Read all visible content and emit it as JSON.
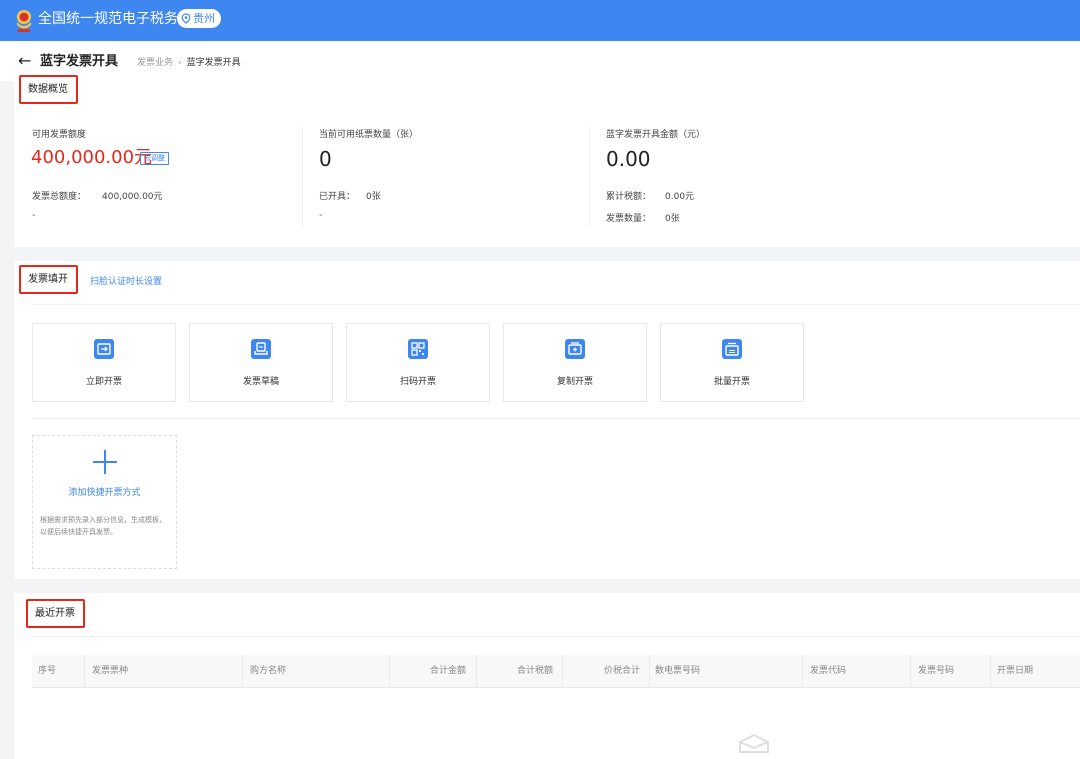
{
  "topbar": {
    "title": "全国统一规范电子税务局",
    "region": "贵州"
  },
  "header": {
    "title": "蓝字发票开具",
    "breadcrumb": [
      "发票业务",
      "蓝字发票开具"
    ]
  },
  "overview": {
    "section_label": "数据概览",
    "col1": {
      "label": "可用发票额度",
      "value": "400,000.00元",
      "button": "去调整",
      "total_label": "发票总额度：",
      "total_value": "400,000.00元",
      "dash": "-"
    },
    "col2": {
      "label": "当前可用纸票数量（张）",
      "value": "0",
      "issued_label": "已开具：",
      "issued_value": "0张",
      "dash": "-"
    },
    "col3": {
      "label": "蓝字发票开具金额（元）",
      "value": "0.00",
      "tax_label": "累计税额：",
      "tax_value": "0.00元",
      "count_label": "发票数量：",
      "count_value": "0张"
    }
  },
  "fill": {
    "section_label": "发票填开",
    "setting_link": "扫脸认证时长设置",
    "tiles": [
      {
        "label": "立即开票",
        "icon": "invoice-now-icon"
      },
      {
        "label": "发票草稿",
        "icon": "draft-icon"
      },
      {
        "label": "扫码开票",
        "icon": "qr-code-icon"
      },
      {
        "label": "复制开票",
        "icon": "copy-invoice-icon"
      },
      {
        "label": "批量开票",
        "icon": "batch-invoice-icon"
      }
    ],
    "add_tile": {
      "title": "添加快捷开票方式",
      "desc": "根据需求预先录入部分信息，生成模板，以便后续快捷开具发票。"
    }
  },
  "recent": {
    "section_label": "最近开票",
    "columns": [
      "序号",
      "发票票种",
      "购方名称",
      "合计金额",
      "合计税额",
      "价税合计",
      "数电票号码",
      "发票代码",
      "发票号码",
      "开票日期"
    ]
  },
  "colors": {
    "primary": "#3e87f0",
    "alert": "#e4291c"
  }
}
